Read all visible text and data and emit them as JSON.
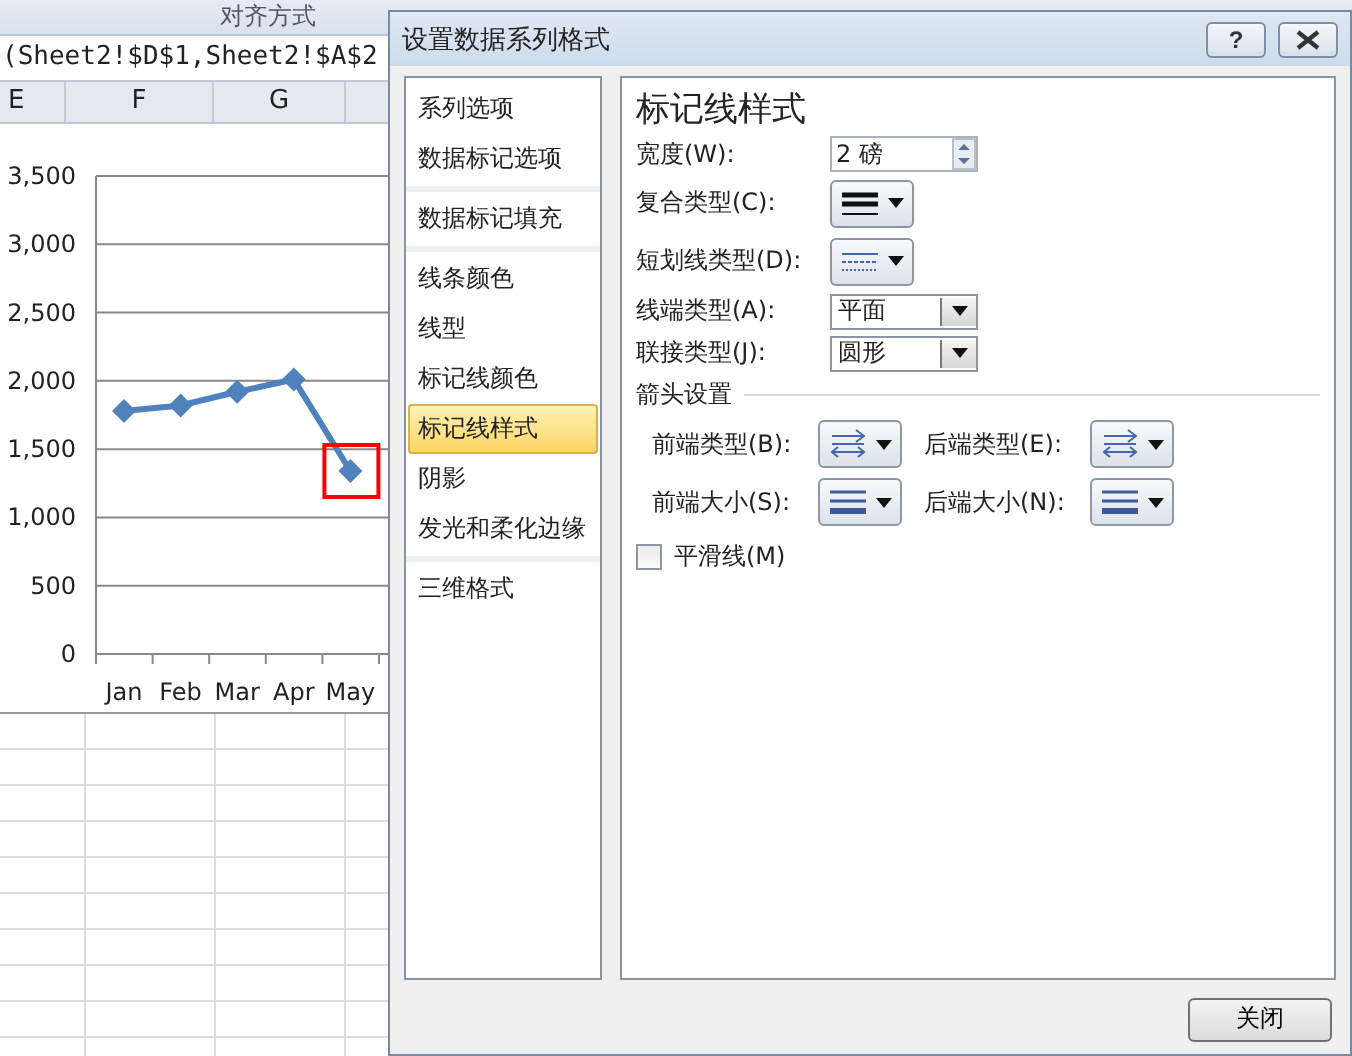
{
  "ribbon": {
    "group_labels": [
      "对齐方式"
    ]
  },
  "formula_bar": {
    "text": "(Sheet2!$D$1,Sheet2!$A$2"
  },
  "columns": [
    "E",
    "F",
    "G"
  ],
  "chart": {
    "chart_data": {
      "type": "line",
      "categories": [
        "Jan",
        "Feb",
        "Mar",
        "Apr",
        "May"
      ],
      "series": [
        {
          "color": "#4f81bd",
          "marker": "diamond",
          "values": [
            1780,
            1820,
            1920,
            2010,
            1340
          ]
        }
      ],
      "grid": true,
      "ylim": [
        0,
        3500
      ],
      "yticks": [
        {
          "value": 0,
          "label": "0"
        },
        {
          "value": 500,
          "label": "500"
        },
        {
          "value": 1000,
          "label": "1,000"
        },
        {
          "value": 1500,
          "label": "1,500"
        },
        {
          "value": 2000,
          "label": "2,000"
        },
        {
          "value": 2500,
          "label": "2,500"
        },
        {
          "value": 3000,
          "label": "3,000"
        },
        {
          "value": 3500,
          "label": "3,500"
        }
      ],
      "annotations": [
        {
          "x": "May"
        }
      ]
    }
  },
  "dialog": {
    "title": "设置数据系列格式",
    "help_button": "?",
    "nav_groups": [
      [
        {
          "label": "系列选项",
          "selected": false
        },
        {
          "label": "数据标记选项",
          "selected": false
        }
      ],
      [
        {
          "label": "数据标记填充",
          "selected": false
        }
      ],
      [
        {
          "label": "线条颜色",
          "selected": false
        },
        {
          "label": "线型",
          "selected": false
        },
        {
          "label": "标记线颜色",
          "selected": false
        },
        {
          "label": "标记线样式",
          "selected": true
        },
        {
          "label": "阴影",
          "selected": false
        },
        {
          "label": "发光和柔化边缘",
          "selected": false
        }
      ],
      [
        {
          "label": "三维格式",
          "selected": false
        }
      ]
    ],
    "heading": "标记线样式",
    "rows": [
      {
        "kind": "spinner",
        "label": "宽度(W):",
        "value": "2 磅"
      },
      {
        "kind": "compound",
        "label": "复合类型(C):"
      },
      {
        "kind": "dash",
        "label": "短划线类型(D):"
      },
      {
        "kind": "select",
        "label": "线端类型(A):",
        "value": "平面"
      },
      {
        "kind": "select",
        "label": "联接类型(J):",
        "value": "圆形"
      }
    ],
    "arrow_section": "箭头设置",
    "arrow_items": [
      {
        "kind": "arrow-type",
        "label": "前端类型(B):"
      },
      {
        "kind": "arrow-type",
        "label": "后端类型(E):"
      },
      {
        "kind": "arrow-size",
        "label": "前端大小(S):"
      },
      {
        "kind": "arrow-size",
        "label": "后端大小(N):"
      }
    ],
    "smooth_checkbox": {
      "label": "平滑线(M)",
      "checked": false
    },
    "close_button": "关闭"
  }
}
